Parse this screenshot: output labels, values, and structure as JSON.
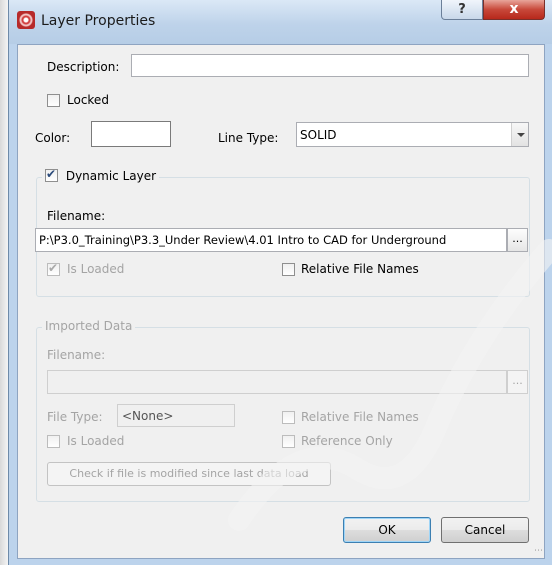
{
  "window": {
    "title": "Layer Properties",
    "help_glyph": "?",
    "close_glyph": "x"
  },
  "fields": {
    "description_label": "Description:",
    "description_value": "",
    "locked_label": "Locked",
    "color_label": "Color:",
    "line_type_label": "Line Type:",
    "line_type_value": "SOLID"
  },
  "dynamic_layer": {
    "checkbox_label": "Dynamic Layer",
    "checked": true,
    "filename_label": "Filename:",
    "filename_value": "P:\\P3.0_Training\\P3.3_Under Review\\4.01 Intro to CAD for Underground",
    "browse_label": "...",
    "is_loaded_label": "Is Loaded",
    "relative_names_label": "Relative File Names"
  },
  "imported_data": {
    "group_title": "Imported Data",
    "filename_label": "Filename:",
    "filename_value": "",
    "browse_label": "...",
    "file_type_label": "File Type:",
    "file_type_value": "<None>",
    "relative_names_label": "Relative File Names",
    "is_loaded_label": "Is Loaded",
    "reference_only_label": "Reference Only",
    "check_modified_label": "Check if file is modified since last data load"
  },
  "buttons": {
    "ok": "OK",
    "cancel": "Cancel"
  },
  "colors": {
    "accent": "#3c7fb1",
    "title_bar": "#bed3ea",
    "close": "#c8483a"
  }
}
